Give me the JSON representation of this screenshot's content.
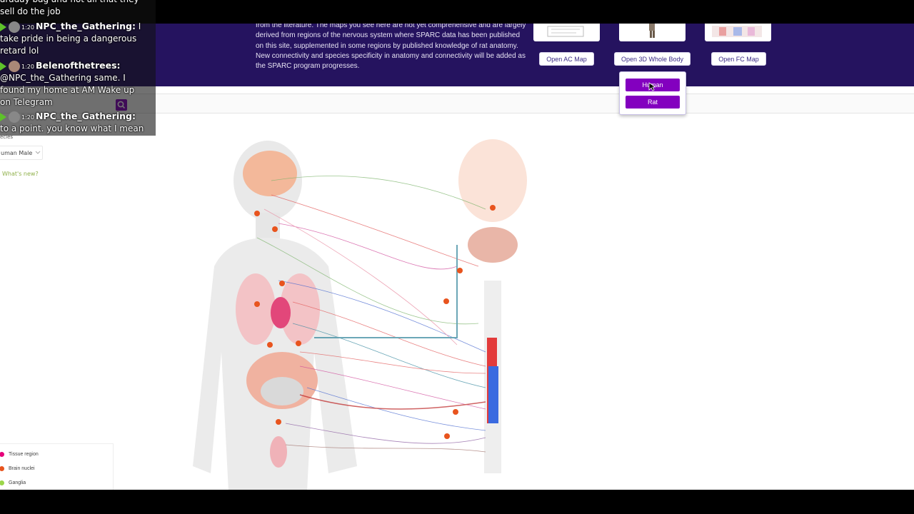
{
  "hero": {
    "paragraph": "from the literature. The maps you see here are not yet comprehensive and are largely derived from regions of the nervous system where SPARC data has been published on this site, supplemented in some regions by published knowledge of rat anatomy. New connectivity and species specificity in anatomy and connectivity will be added as the SPARC program progresses.",
    "buttons": {
      "ac": "Open AC Map",
      "whole_body": "Open 3D Whole Body",
      "fc": "Open FC Map"
    }
  },
  "dropdown": {
    "options": [
      "Human",
      "Rat"
    ]
  },
  "sidebar": {
    "species_label": "ecies",
    "species_value": "uman Male",
    "whats_new": "What's new?"
  },
  "legend": {
    "items": [
      {
        "label": "Tissue region",
        "color": "#e6007a"
      },
      {
        "label": "Brain nuclei",
        "color": "#e8541e"
      },
      {
        "label": "Ganglia",
        "color": "#9bd64a"
      }
    ]
  },
  "chat": {
    "messages": [
      {
        "lines": [
          "araday bag and not all that they",
          "sell do the job"
        ]
      },
      {
        "time": "1:20",
        "user": "NPC_the_Gathering:",
        "lines": [
          "I",
          "take pride in being a dangerous",
          "retard lol"
        ]
      },
      {
        "time": "1:20",
        "user": "Belenofthetrees:",
        "lines": [
          "@NPC_the_Gathering same. I",
          "found my home at AM Wake up",
          "on Telegram"
        ]
      },
      {
        "time": "1:20",
        "user": "NPC_the_Gathering:",
        "lines": [
          "to a point. you know what I mean"
        ]
      }
    ]
  },
  "colors": {
    "hero_bg": "#25135f",
    "accent": "#8300bf",
    "button_text": "#3a2a86"
  }
}
